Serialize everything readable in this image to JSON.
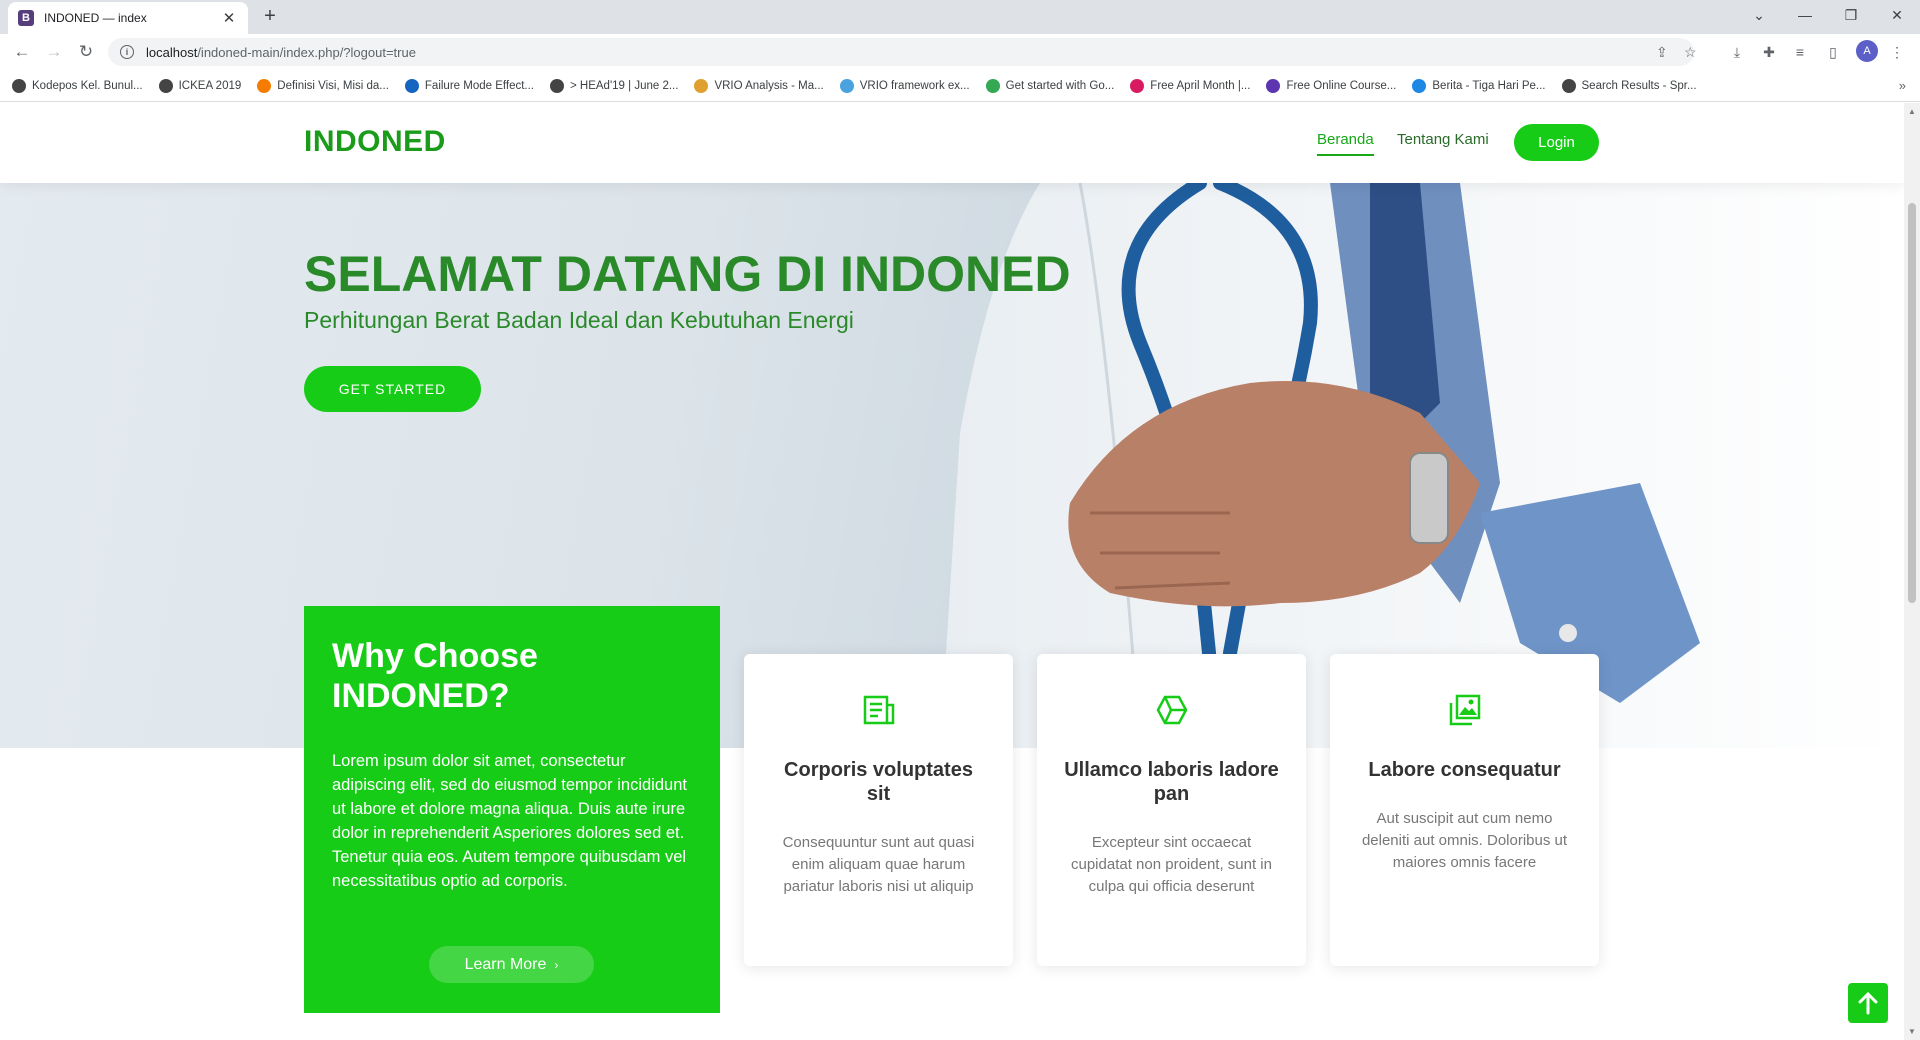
{
  "browser": {
    "tab_title": "INDONED — index",
    "tab_favicon_letter": "B",
    "url_host": "localhost",
    "url_path": "/indoned-main/index.php/?logout=true",
    "profile_initial": "A",
    "bookmarks": [
      {
        "label": "Kodepos Kel. Bunul...",
        "color": "#444"
      },
      {
        "label": "ICKEA 2019",
        "color": "#444"
      },
      {
        "label": "Definisi Visi, Misi da...",
        "color": "#f57c00"
      },
      {
        "label": "Failure Mode Effect...",
        "color": "#1565c0"
      },
      {
        "label": "> HEAd'19 | June 2...",
        "color": "#444"
      },
      {
        "label": "VRIO Analysis - Ma...",
        "color": "#e0a030"
      },
      {
        "label": "VRIO framework ex...",
        "color": "#4aa3df"
      },
      {
        "label": "Get started with Go...",
        "color": "#34a853"
      },
      {
        "label": "Free April Month |...",
        "color": "#d81b60"
      },
      {
        "label": "Free Online Course...",
        "color": "#5e35b1"
      },
      {
        "label": "Berita - Tiga Hari Pe...",
        "color": "#1e88e5"
      },
      {
        "label": "Search Results - Spr...",
        "color": "#444"
      }
    ]
  },
  "header": {
    "logo": "INDONED",
    "nav": [
      {
        "label": "Beranda",
        "active": true
      },
      {
        "label": "Tentang Kami",
        "active": false
      }
    ],
    "login_label": "Login"
  },
  "hero": {
    "title": "SELAMAT DATANG DI INDONED",
    "subtitle": "Perhitungan Berat Badan Ideal dan Kebutuhan Energi",
    "cta_label": "GET STARTED"
  },
  "why": {
    "title": "Why Choose INDONED?",
    "text": "Lorem ipsum dolor sit amet, consectetur adipiscing elit, sed do eiusmod tempor incididunt ut labore et dolore magna aliqua. Duis aute irure dolor in reprehenderit Asperiores dolores sed et. Tenetur quia eos. Autem tempore quibusdam vel necessitatibus optio ad corporis.",
    "button_label": "Learn More"
  },
  "cards": [
    {
      "icon": "document-icon",
      "title": "Corporis voluptates sit",
      "text": "Consequuntur sunt aut quasi enim aliquam quae harum pariatur laboris nisi ut aliquip"
    },
    {
      "icon": "cube-icon",
      "title": "Ullamco laboris ladore pan",
      "text": "Excepteur sint occaecat cupidatat non proident, sunt in culpa qui officia deserunt"
    },
    {
      "icon": "images-icon",
      "title": "Labore consequatur",
      "text": "Aut suscipit aut cum nemo deleniti aut omnis. Doloribus ut maiores omnis facere"
    }
  ],
  "colors": {
    "brand_green": "#16cc16",
    "title_green": "#2a8a2a"
  }
}
